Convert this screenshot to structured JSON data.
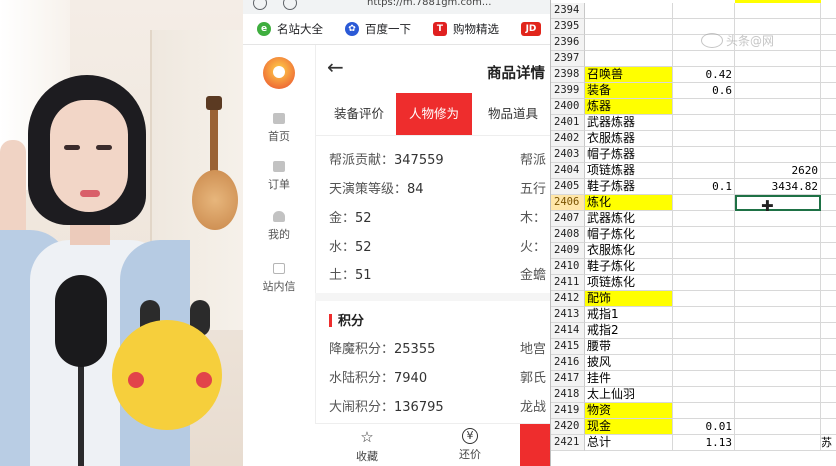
{
  "browser": {
    "url": "https://m.7881gm.com...",
    "bookmarks": [
      {
        "label": "名站大全",
        "icon": "green-circle-icon"
      },
      {
        "label": "百度一下",
        "icon": "baidu-paw-icon"
      },
      {
        "label": "购物精选",
        "icon": "t-shop-icon"
      },
      {
        "label": "JD",
        "icon": "jd-icon"
      }
    ]
  },
  "nav": {
    "items": [
      {
        "label": "首页",
        "icon": "home-icon"
      },
      {
        "label": "订单",
        "icon": "order-icon"
      },
      {
        "label": "我的",
        "icon": "user-icon"
      },
      {
        "label": "站内信",
        "icon": "envelope-icon"
      }
    ]
  },
  "detail": {
    "title": "商品详情",
    "tabs": [
      {
        "label": "装备评价"
      },
      {
        "label": "人物修为"
      },
      {
        "label": "物品道具"
      }
    ],
    "attrs": [
      {
        "label": "帮派贡献：",
        "value": "347559"
      },
      {
        "label": "帮派",
        "value": ""
      },
      {
        "label": "天演策等级：",
        "value": "84"
      },
      {
        "label": "五行",
        "value": ""
      },
      {
        "label": "金：",
        "value": "52"
      },
      {
        "label": "木：",
        "value": ""
      },
      {
        "label": "水：",
        "value": "52"
      },
      {
        "label": "火：",
        "value": ""
      },
      {
        "label": "土：",
        "value": "51"
      },
      {
        "label": "金蟾",
        "value": ""
      }
    ],
    "score_title": "积分",
    "scores": [
      {
        "label": "降魔积分：",
        "value": "25355"
      },
      {
        "label": "地宫",
        "value": ""
      },
      {
        "label": "水陆积分：",
        "value": "7940"
      },
      {
        "label": "郭氏",
        "value": ""
      },
      {
        "label": "大闹积分：",
        "value": "136795"
      },
      {
        "label": "龙战",
        "value": ""
      }
    ],
    "bottom": [
      {
        "label": "收藏",
        "icon": "star-icon"
      },
      {
        "label": "还价",
        "icon": "yen-icon"
      }
    ]
  },
  "sheet": {
    "rows": [
      {
        "n": "2394",
        "a": "",
        "b": "",
        "c": "",
        "hl": false
      },
      {
        "n": "2395",
        "a": "",
        "b": "",
        "c": "",
        "hl": false
      },
      {
        "n": "2396",
        "a": "",
        "b": "",
        "c": "",
        "hl": false
      },
      {
        "n": "2397",
        "a": "",
        "b": "",
        "c": "",
        "hl": false
      },
      {
        "n": "2398",
        "a": "召唤兽",
        "b": "0.42",
        "c": "",
        "hl": true
      },
      {
        "n": "2399",
        "a": "装备",
        "b": "0.6",
        "c": "",
        "hl": true
      },
      {
        "n": "2400",
        "a": "炼器",
        "b": "",
        "c": "",
        "hl": true
      },
      {
        "n": "2401",
        "a": "武器炼器",
        "b": "",
        "c": "",
        "hl": false
      },
      {
        "n": "2402",
        "a": "衣服炼器",
        "b": "",
        "c": "",
        "hl": false
      },
      {
        "n": "2403",
        "a": "帽子炼器",
        "b": "",
        "c": "",
        "hl": false
      },
      {
        "n": "2404",
        "a": "项链炼器",
        "b": "",
        "c": "2620",
        "hl": false
      },
      {
        "n": "2405",
        "a": "鞋子炼器",
        "b": "0.1",
        "c": "3434.82",
        "hl": false
      },
      {
        "n": "2406",
        "a": "炼化",
        "b": "",
        "c": "",
        "hl": true,
        "selected": true
      },
      {
        "n": "2407",
        "a": "武器炼化",
        "b": "",
        "c": "",
        "hl": false
      },
      {
        "n": "2408",
        "a": "帽子炼化",
        "b": "",
        "c": "",
        "hl": false
      },
      {
        "n": "2409",
        "a": "衣服炼化",
        "b": "",
        "c": "",
        "hl": false
      },
      {
        "n": "2410",
        "a": "鞋子炼化",
        "b": "",
        "c": "",
        "hl": false
      },
      {
        "n": "2411",
        "a": "项链炼化",
        "b": "",
        "c": "",
        "hl": false
      },
      {
        "n": "2412",
        "a": "配饰",
        "b": "",
        "c": "",
        "hl": true
      },
      {
        "n": "2413",
        "a": "戒指1",
        "b": "",
        "c": "",
        "hl": false
      },
      {
        "n": "2414",
        "a": "戒指2",
        "b": "",
        "c": "",
        "hl": false
      },
      {
        "n": "2415",
        "a": "腰带",
        "b": "",
        "c": "",
        "hl": false
      },
      {
        "n": "2416",
        "a": "披风",
        "b": "",
        "c": "",
        "hl": false
      },
      {
        "n": "2417",
        "a": "挂件",
        "b": "",
        "c": "",
        "hl": false
      },
      {
        "n": "2418",
        "a": "太上仙羽",
        "b": "",
        "c": "",
        "hl": false
      },
      {
        "n": "2419",
        "a": "物资",
        "b": "",
        "c": "",
        "hl": true
      },
      {
        "n": "2420",
        "a": "现金",
        "b": "0.01",
        "c": "",
        "hl": true
      },
      {
        "n": "2421",
        "a": "总计",
        "b": "1.13",
        "c": "",
        "hl": false,
        "d": "苏"
      }
    ],
    "watermark": "头条@网"
  },
  "colors": {
    "accent_red": "#ee2d2d",
    "highlight_yellow": "#ffff00",
    "selection_green": "#1e7145"
  }
}
